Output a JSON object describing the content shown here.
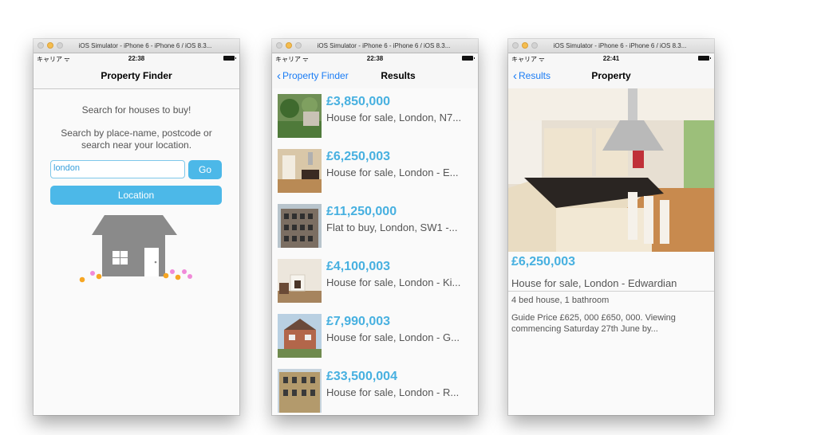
{
  "simulator": {
    "window_title": "iOS Simulator - iPhone 6 - iPhone 6 / iOS 8.3..."
  },
  "screens": [
    {
      "status": {
        "carrier": "キャリア ᯤ",
        "time": "22:38"
      },
      "nav": {
        "title": "Property Finder"
      },
      "intro": "Search for houses to buy!",
      "instructions": "Search by place-name, postcode or search near your location.",
      "search": {
        "value": "london"
      },
      "go_label": "Go",
      "location_label": "Location"
    },
    {
      "status": {
        "carrier": "キャリア ᯤ",
        "time": "22:38"
      },
      "nav": {
        "back_label": "Property Finder",
        "title": "Results"
      },
      "results": [
        {
          "price": "£3,850,000",
          "title": "House for sale, London, N7..."
        },
        {
          "price": "£6,250,003",
          "title": "House for sale, London - E..."
        },
        {
          "price": "£11,250,000",
          "title": "Flat to buy, London, SW1 -..."
        },
        {
          "price": "£4,100,003",
          "title": "House for sale, London - Ki..."
        },
        {
          "price": "£7,990,003",
          "title": "House for sale, London - G..."
        },
        {
          "price": "£33,500,004",
          "title": "House for sale, London - R..."
        }
      ]
    },
    {
      "status": {
        "carrier": "キャリア ᯤ",
        "time": "22:41"
      },
      "nav": {
        "back_label": "Results",
        "title": "Property"
      },
      "price": "£6,250,003",
      "title": "House for sale, London - Edwardian",
      "rooms": "4 bed house, 1 bathroom",
      "summary": "Guide Price £625, 000 £650, 000. Viewing commencing Saturday 27th June by..."
    }
  ],
  "colors": {
    "accent": "#47b0e0",
    "button": "#4cb8e8",
    "ios_blue": "#1a7cf5",
    "house_gray": "#8a8a8a"
  }
}
